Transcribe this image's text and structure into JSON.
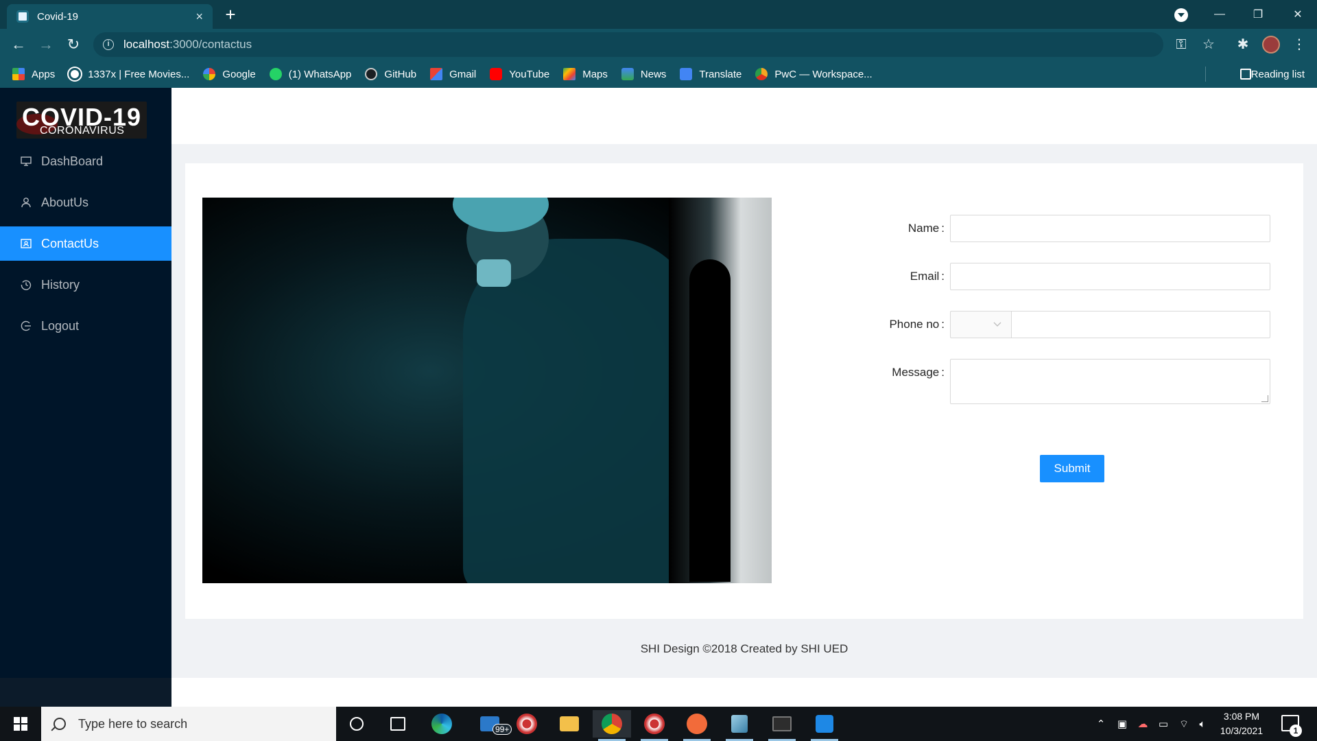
{
  "browser": {
    "tab_title": "Covid-19",
    "tab_close": "×",
    "new_tab": "+",
    "url_host": "localhost",
    "url_path": ":3000/contactus",
    "window_controls": {
      "minimize": "—",
      "maximize": "❐",
      "close": "✕"
    },
    "bookmarks": [
      {
        "label": "Apps",
        "icon": "apps-grid-icon",
        "color": "#4285f4"
      },
      {
        "label": "1337x | Free Movies...",
        "icon": "globe-icon",
        "color": "#ffffff"
      },
      {
        "label": "Google",
        "icon": "google-icon",
        "color": "#ffffff"
      },
      {
        "label": "(1) WhatsApp",
        "icon": "whatsapp-icon",
        "color": "#25d366"
      },
      {
        "label": "GitHub",
        "icon": "github-icon",
        "color": "#222222"
      },
      {
        "label": "Gmail",
        "icon": "gmail-icon",
        "color": "#ea4335"
      },
      {
        "label": "YouTube",
        "icon": "youtube-icon",
        "color": "#ff0000"
      },
      {
        "label": "Maps",
        "icon": "maps-icon",
        "color": "#34a853"
      },
      {
        "label": "News",
        "icon": "news-icon",
        "color": "#4285f4"
      },
      {
        "label": "Translate",
        "icon": "translate-icon",
        "color": "#4285f4"
      },
      {
        "label": "PwC — Workspace...",
        "icon": "pwc-icon",
        "color": "#f5a623"
      }
    ],
    "reading_list": "Reading list"
  },
  "sidebar": {
    "logo_big": "COVID-19",
    "logo_small": "CORONAVIRUS",
    "items": [
      {
        "label": "DashBoard",
        "icon": "desktop-icon",
        "active": false
      },
      {
        "label": "AboutUs",
        "icon": "user-icon",
        "active": false
      },
      {
        "label": "ContactUs",
        "icon": "contacts-icon",
        "active": true
      },
      {
        "label": "History",
        "icon": "history-icon",
        "active": false
      },
      {
        "label": "Logout",
        "icon": "logout-icon",
        "active": false
      }
    ]
  },
  "form": {
    "name_label": "Name",
    "email_label": "Email",
    "phone_label": "Phone no",
    "message_label": "Message",
    "colon": ":",
    "submit_label": "Submit"
  },
  "footer": {
    "text": "SHI Design ©2018 Created by SHI UED"
  },
  "taskbar": {
    "search_placeholder": "Type here to search",
    "mail_badge": "99+",
    "time": "3:08 PM",
    "date": "10/3/2021",
    "notification_count": "1"
  },
  "colors": {
    "primary": "#1890ff",
    "sider_bg": "#001529",
    "browser_frame": "#125262"
  }
}
